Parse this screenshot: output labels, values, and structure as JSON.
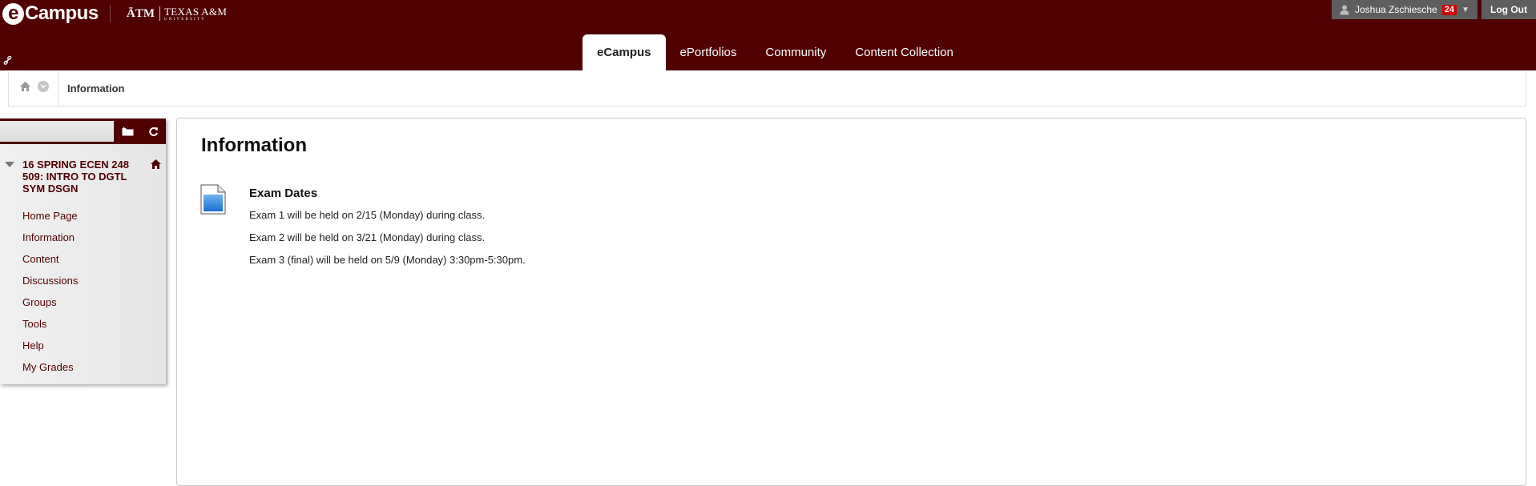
{
  "header": {
    "logo_text": "Campus",
    "logo_mark": "e",
    "institution_mark": "ĀTM",
    "institution_name": "TEXAS A&M",
    "institution_sub": "UNIVERSITY",
    "user_name": "Joshua Zschiesche",
    "notification_count": "24",
    "logout_label": "Log Out",
    "tabs": [
      {
        "label": "eCampus",
        "active": true
      },
      {
        "label": "ePortfolios",
        "active": false
      },
      {
        "label": "Community",
        "active": false
      },
      {
        "label": "Content Collection",
        "active": false
      }
    ]
  },
  "breadcrumb": {
    "current": "Information",
    "icons": [
      "home-icon",
      "chevron-down-icon"
    ]
  },
  "course_menu": {
    "toolbar_icons": [
      "folder-icon",
      "refresh-icon"
    ],
    "course_title": "16 SPRING ECEN 248 509: INTRO TO DGTL SYM DSGN",
    "items": [
      {
        "label": "Home Page"
      },
      {
        "label": "Information"
      },
      {
        "label": "Content"
      },
      {
        "label": "Discussions"
      },
      {
        "label": "Groups"
      },
      {
        "label": "Tools"
      },
      {
        "label": "Help"
      },
      {
        "label": "My Grades"
      }
    ]
  },
  "content": {
    "page_title": "Information",
    "item": {
      "icon": "document-icon",
      "title": "Exam Dates",
      "lines": [
        "Exam 1 will be held on 2/15 (Monday) during class.",
        "Exam 2 will be held on 3/21 (Monday) during class.",
        "Exam 3 (final) will be held on 5/9 (Monday) 3:30pm-5:30pm."
      ]
    }
  },
  "colors": {
    "brand_maroon": "#500000",
    "user_bar_gray": "#5e5e5e",
    "badge_red": "#cc0000"
  }
}
